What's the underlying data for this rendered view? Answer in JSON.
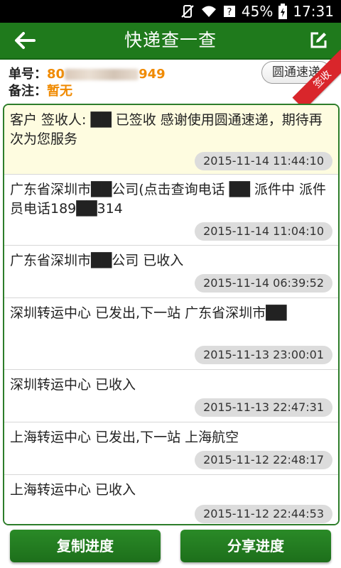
{
  "status_bar": {
    "battery": "45%",
    "time": "17:31",
    "icons": [
      "silent-icon",
      "wifi-icon",
      "signal-icon",
      "battery-icon"
    ]
  },
  "app_bar": {
    "title": "快递查一查",
    "back_icon": "arrow-left-icon",
    "edit_icon": "edit-icon"
  },
  "tracking": {
    "number_label": "单号：",
    "number_prefix": "80",
    "number_suffix": "949",
    "note_label": "备注：",
    "note_value": "暂无",
    "carrier": "圆通速递",
    "status_stamp": "签收"
  },
  "events": [
    {
      "text": "客户 签收人: ██ 已签收 感谢使用圆通速递，期待再次为您服务",
      "time": "2015-11-14 11:44:10"
    },
    {
      "text": "广东省深圳市██公司(点击查询电话 ██ 派件中 派件员电话189██314",
      "time": "2015-11-14 11:04:10"
    },
    {
      "text": "广东省深圳市██公司 已收入",
      "time": "2015-11-14 06:39:52"
    },
    {
      "text": "深圳转运中心 已发出,下一站 广东省深圳市██",
      "time": "2015-11-13 23:00:01"
    },
    {
      "text": "深圳转运中心 已收入",
      "time": "2015-11-13 22:47:31"
    },
    {
      "text": "上海转运中心 已发出,下一站 上海航空",
      "time": "2015-11-12 22:48:17"
    },
    {
      "text": "上海转运中心 已收入",
      "time": "2015-11-12 22:44:53"
    }
  ],
  "buttons": {
    "copy": "复制进度",
    "share": "分享进度"
  },
  "colors": {
    "primary": "#1f7a1c",
    "accent": "#f08a00",
    "stamp": "#d9262b",
    "highlight": "#fefce0"
  }
}
